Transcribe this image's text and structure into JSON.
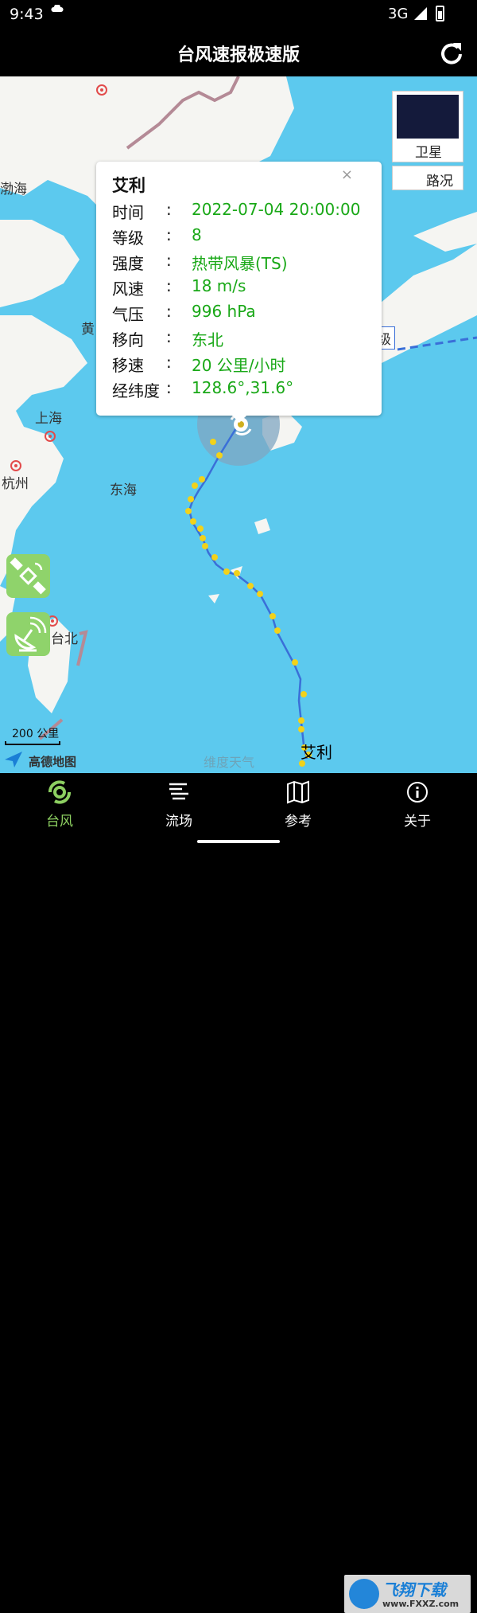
{
  "status_bar": {
    "time": "9:43",
    "network": "3G"
  },
  "app": {
    "title": "台风速报极速版"
  },
  "map": {
    "labels": {
      "bohai": "渤海",
      "huanghai": "黄",
      "shanghai": "上海",
      "hangzhou": "杭州",
      "donghai": "东海",
      "taibei": "台北",
      "level_cut": "级"
    },
    "layer_buttons": {
      "satellite": "卫星",
      "traffic": "路况"
    },
    "scale": "200 公里",
    "provider": "高德地图",
    "watermark": "维度天气",
    "typhoon_label": "艾利"
  },
  "popup": {
    "name": "艾利",
    "close": "×",
    "rows": [
      {
        "key": "时间",
        "sep": ":",
        "value": "2022-07-04 20:00:00"
      },
      {
        "key": "等级",
        "sep": ":",
        "value": "8"
      },
      {
        "key": "强度",
        "sep": ":",
        "value": "热带风暴(TS)"
      },
      {
        "key": "风速",
        "sep": ":",
        "value": "18 m/s"
      },
      {
        "key": "气压",
        "sep": ":",
        "value": "996 hPa"
      },
      {
        "key": "移向",
        "sep": ":",
        "value": "东北"
      },
      {
        "key": "移速",
        "sep": ":",
        "value": "20 公里/小时"
      },
      {
        "key": "经纬度",
        "sep": ":",
        "value": "128.6°,31.6°"
      }
    ]
  },
  "nav": {
    "tabs": [
      {
        "label": "台风",
        "active": true
      },
      {
        "label": "流场",
        "active": false
      },
      {
        "label": "参考",
        "active": false
      },
      {
        "label": "关于",
        "active": false
      }
    ]
  },
  "watermark_logo": {
    "title": "飞翔下载",
    "url": "www.FXXZ.com"
  },
  "colors": {
    "sea": "#5cc9ee",
    "land": "#f5f5f2",
    "active": "#8dd061",
    "value": "#19a817",
    "track": "#3a6fd8",
    "point": "#f2d21a"
  }
}
